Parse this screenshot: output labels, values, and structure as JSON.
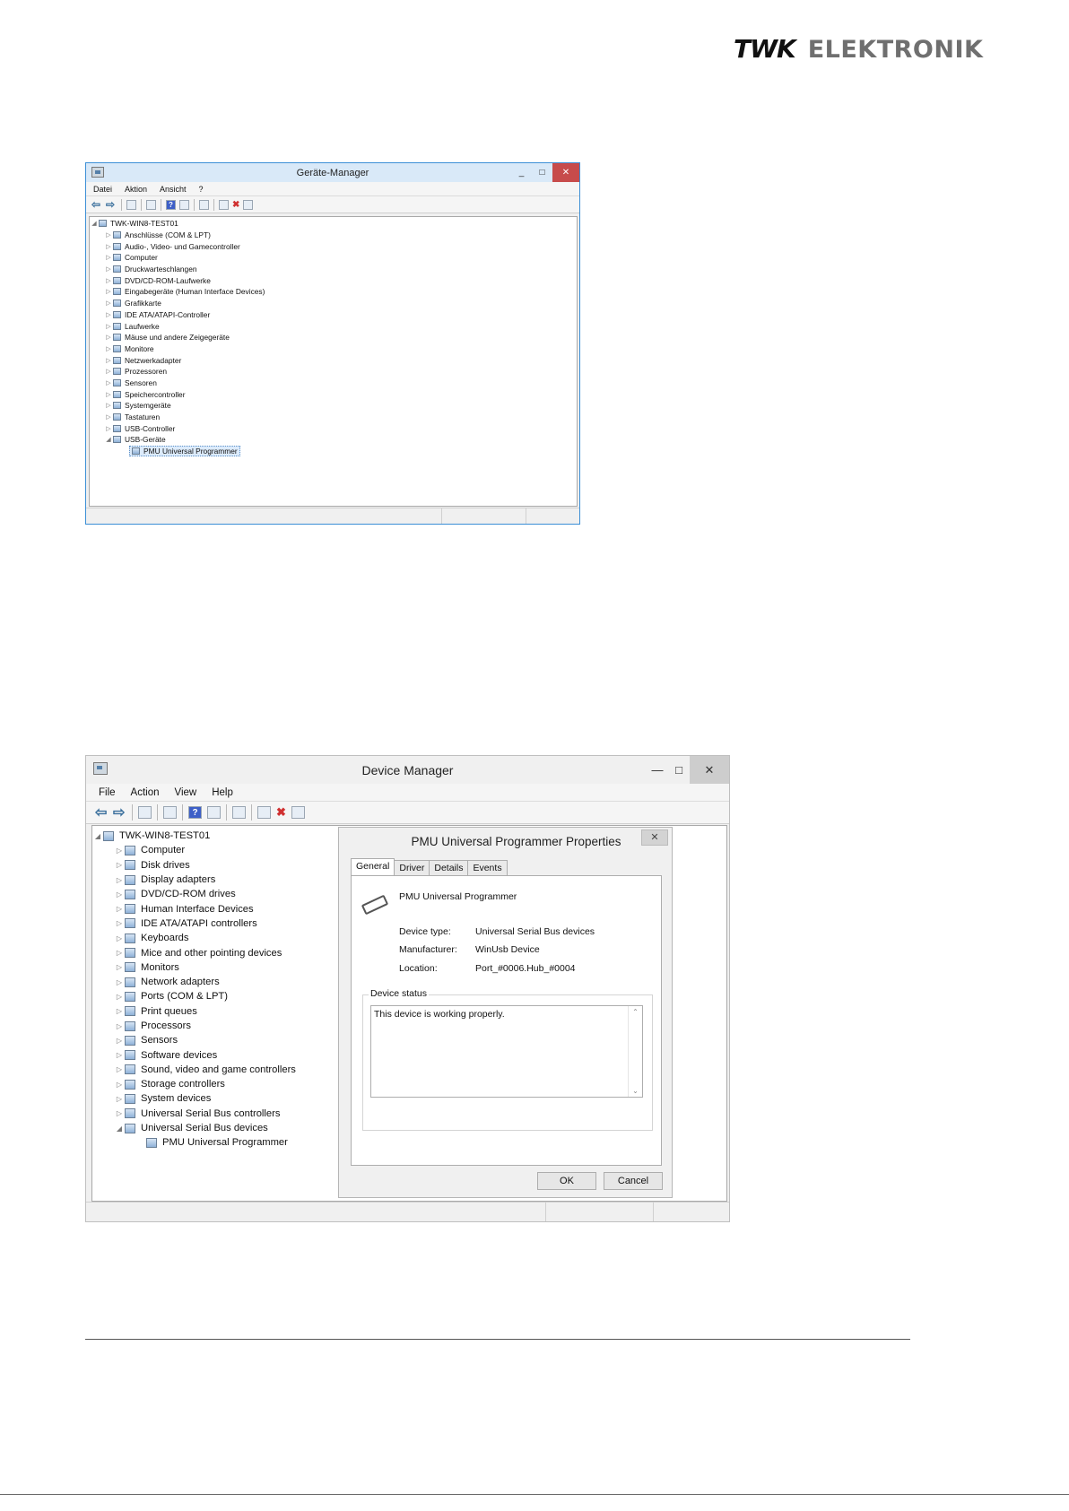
{
  "brand": {
    "logo_part1": "TWK",
    "logo_part2": "ELEKTRONIK"
  },
  "window_de": {
    "title": "Geräte-Manager",
    "minimize": "_",
    "maximize": "□",
    "close": "✕",
    "menu": [
      "Datei",
      "Aktion",
      "Ansicht",
      "?"
    ],
    "root": "TWK-WIN8-TEST01",
    "categories": [
      "Anschlüsse (COM & LPT)",
      "Audio-, Video- und Gamecontroller",
      "Computer",
      "Druckwarteschlangen",
      "DVD/CD-ROM-Laufwerke",
      "Eingabegeräte (Human Interface Devices)",
      "Grafikkarte",
      "IDE ATA/ATAPI-Controller",
      "Laufwerke",
      "Mäuse und andere Zeigegeräte",
      "Monitore",
      "Netzwerkadapter",
      "Prozessoren",
      "Sensoren",
      "Speichercontroller",
      "Systemgeräte",
      "Tastaturen",
      "USB-Controller",
      "USB-Geräte"
    ],
    "expanded_child": "PMU Universal Programmer"
  },
  "window_en": {
    "title": "Device Manager",
    "minimize": "—",
    "maximize": "□",
    "close": "✕",
    "menu": [
      "File",
      "Action",
      "View",
      "Help"
    ],
    "root": "TWK-WIN8-TEST01",
    "categories": [
      "Computer",
      "Disk drives",
      "Display adapters",
      "DVD/CD-ROM drives",
      "Human Interface Devices",
      "IDE ATA/ATAPI controllers",
      "Keyboards",
      "Mice and other pointing devices",
      "Monitors",
      "Network adapters",
      "Ports (COM & LPT)",
      "Print queues",
      "Processors",
      "Sensors",
      "Software devices",
      "Sound, video and game controllers",
      "Storage controllers",
      "System devices",
      "Universal Serial Bus controllers",
      "Universal Serial Bus devices"
    ],
    "expanded_child": "PMU Universal Programmer"
  },
  "properties_dialog": {
    "title": "PMU Universal Programmer Properties",
    "close": "✕",
    "tabs": [
      "General",
      "Driver",
      "Details",
      "Events"
    ],
    "device_name": "PMU Universal Programmer",
    "device_type_label": "Device type:",
    "device_type_value": "Universal Serial Bus devices",
    "manufacturer_label": "Manufacturer:",
    "manufacturer_value": "WinUsb Device",
    "location_label": "Location:",
    "location_value": "Port_#0006.Hub_#0004",
    "status_group": "Device status",
    "status_text": "This device is working properly.",
    "ok": "OK",
    "cancel": "Cancel"
  }
}
